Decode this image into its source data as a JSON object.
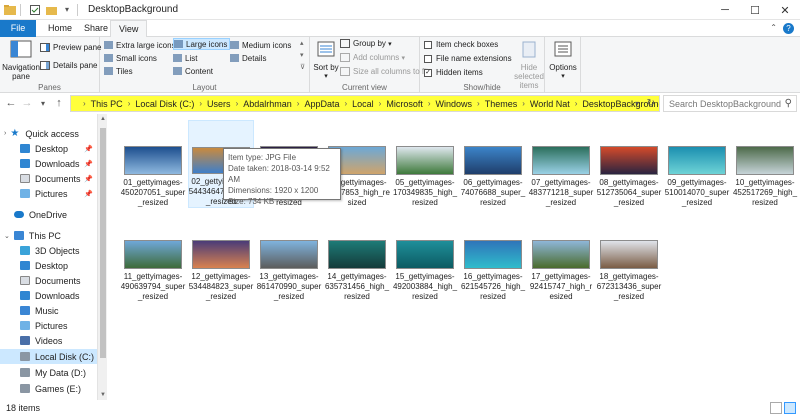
{
  "window": {
    "title": "DesktopBackground"
  },
  "ribbon_tabs": [
    "File",
    "Home",
    "Share",
    "View"
  ],
  "ribbon": {
    "panes": {
      "navigation_pane": "Navigation pane",
      "preview_pane": "Preview pane",
      "details_pane": "Details pane",
      "label": "Panes"
    },
    "layout": {
      "label": "Layout",
      "items": [
        "Extra large icons",
        "Large icons",
        "Medium icons",
        "Small icons",
        "List",
        "Details",
        "Tiles",
        "Content"
      ],
      "selected": "Large icons"
    },
    "current_view": {
      "label": "Current view",
      "sort_by": "Sort by",
      "group_by": "Group by",
      "add_columns": "Add columns",
      "size_columns": "Size all columns to fit"
    },
    "show_hide": {
      "label": "Show/hide",
      "item_check_boxes": "Item check boxes",
      "file_name_extensions": "File name extensions",
      "hidden_items": "Hidden items",
      "hide_selected": "Hide selected items",
      "options": "Options"
    }
  },
  "address": {
    "crumbs": [
      "This PC",
      "Local Disk (C:)",
      "Users",
      "Abdalrhman",
      "AppData",
      "Local",
      "Microsoft",
      "Windows",
      "Themes",
      "World Nat",
      "DesktopBackground"
    ],
    "search_placeholder": "Search DesktopBackground",
    "bar_color": "#ffff3b"
  },
  "nav": {
    "quick_access": "Quick access",
    "quick_items": [
      "Desktop",
      "Downloads",
      "Documents",
      "Pictures"
    ],
    "onedrive": "OneDrive",
    "this_pc": "This PC",
    "pc_items": [
      "3D Objects",
      "Desktop",
      "Documents",
      "Downloads",
      "Music",
      "Pictures",
      "Videos",
      "Local Disk (C:)",
      "My Data (D:)",
      "Games (E:)"
    ]
  },
  "files": [
    {
      "name": "01_gettyimages-450207051_super_resized",
      "c1": "#1d4f8f",
      "c2": "#8fb9e0"
    },
    {
      "name": "02_gettyimages-544346474_super_resized",
      "c1": "#c98a3e",
      "c2": "#3f7fc9"
    },
    {
      "name": "03_gettyimages-xxxxxxxxx_super_resized",
      "c1": "#2a1f45",
      "c2": "#c26a3a"
    },
    {
      "name": "04_gettyimages-xx357853_high_resized",
      "c1": "#6da8d6",
      "c2": "#cfa46b"
    },
    {
      "name": "05_gettyimages-170349835_high_resized",
      "c1": "#dfe7ee",
      "c2": "#3e7a3b"
    },
    {
      "name": "06_gettyimages-74076688_super_resized",
      "c1": "#3c84c9",
      "c2": "#1f3e6b"
    },
    {
      "name": "07_gettyimages-483771218_super_resized",
      "c1": "#2b6f5c",
      "c2": "#9ad1e6"
    },
    {
      "name": "08_gettyimages-512735064_super_resized",
      "c1": "#d44a2a",
      "c2": "#2a2440"
    },
    {
      "name": "09_gettyimages-510014070_super_resized",
      "c1": "#1b8fb0",
      "c2": "#6ed3d6"
    },
    {
      "name": "10_gettyimages-452517269_high_resized",
      "c1": "#4d6a4a",
      "c2": "#c6d4d8"
    },
    {
      "name": "11_gettyimages-490639794_super_resized",
      "c1": "#6fa7d8",
      "c2": "#3e6b3a"
    },
    {
      "name": "12_gettyimages-534484823_super_resized",
      "c1": "#4a3c78",
      "c2": "#d9824f"
    },
    {
      "name": "13_gettyimages-861470990_super_resized",
      "c1": "#7fb3de",
      "c2": "#5c5c5c"
    },
    {
      "name": "14_gettyimages-635731456_high_resized",
      "c1": "#1e7b77",
      "c2": "#143b3a"
    },
    {
      "name": "15_gettyimages-492003884_high_resized",
      "c1": "#1f8f9a",
      "c2": "#0c5b62"
    },
    {
      "name": "16_gettyimages-621545726_high_resized",
      "c1": "#2f75b9",
      "c2": "#2fbccb"
    },
    {
      "name": "17_gettyimages-92415747_high_resized",
      "c1": "#8eb6d8",
      "c2": "#4a6b2c"
    },
    {
      "name": "18_gettyimages-672313436_super_resized",
      "c1": "#e0e4ea",
      "c2": "#7a5d45"
    }
  ],
  "tooltip": {
    "type": "Item type: JPG File",
    "date": "Date taken: 2018-03-14 9:52 AM",
    "dims": "Dimensions: 1920 x 1200",
    "size": "Size: 734 KB"
  },
  "status": {
    "count": "18 items"
  }
}
